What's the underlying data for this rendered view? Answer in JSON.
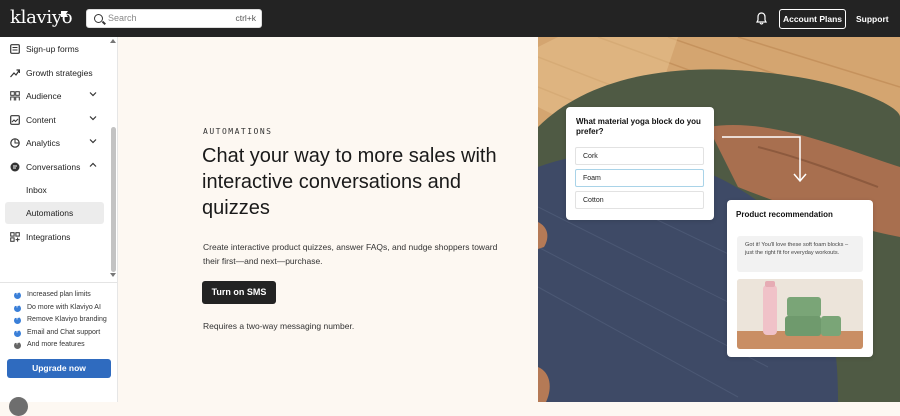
{
  "header": {
    "logo": "klaviyo",
    "search": {
      "placeholder": "Search",
      "shortcut": "ctrl+k"
    },
    "bell_icon": "bell-icon",
    "account_plans": "Account Plans",
    "support": "Support"
  },
  "sidebar": {
    "items": [
      {
        "label": "Sign-up forms",
        "icon": "form-icon"
      },
      {
        "label": "Growth strategies",
        "icon": "trend-icon"
      },
      {
        "label": "Audience",
        "icon": "people-icon",
        "expandable": true
      },
      {
        "label": "Content",
        "icon": "content-icon",
        "expandable": true
      },
      {
        "label": "Analytics",
        "icon": "analytics-icon",
        "expandable": true
      },
      {
        "label": "Conversations",
        "icon": "chat-icon",
        "expanded": true
      },
      {
        "label": "Inbox"
      },
      {
        "label": "Automations",
        "active": true
      },
      {
        "label": "Integrations",
        "icon": "integrations-icon"
      }
    ],
    "features": [
      "Increased plan limits",
      "Do more with Klaviyo AI",
      "Remove Klaviyo branding",
      "Email and Chat support",
      "And more features"
    ],
    "upgrade": "Upgrade now"
  },
  "main": {
    "eyebrow": "AUTOMATIONS",
    "headline": "Chat your way to more sales with interactive conversations and quizzes",
    "description": "Create interactive product quizzes, answer FAQs, and nudge shoppers toward their first—and next—purchase.",
    "cta": "Turn on SMS",
    "note": "Requires a two-way messaging number."
  },
  "hero": {
    "quiz": {
      "question": "What material yoga block do you prefer?",
      "options": [
        "Cork",
        "Foam",
        "Cotton"
      ],
      "selected": "Foam"
    },
    "recommendation": {
      "title": "Product recommendation",
      "message": "Got it! You'll love these soft foam blocks – just the right fit for everyday workouts."
    }
  },
  "colors": {
    "topbar": "#232323",
    "accent": "#2f6bbf",
    "page_bg": "#fdf8f2"
  }
}
